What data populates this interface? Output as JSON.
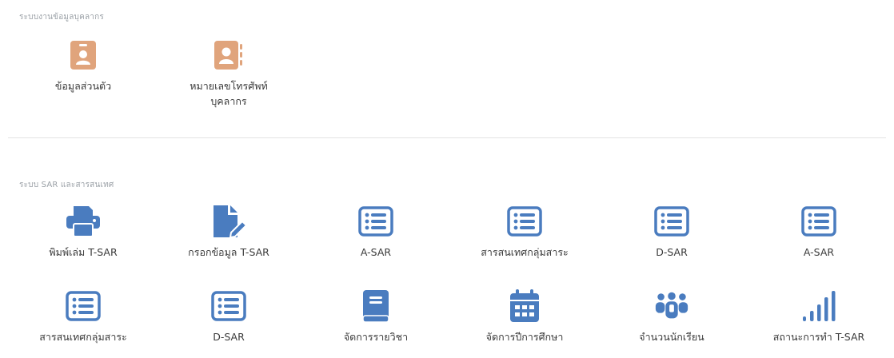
{
  "colors": {
    "personnel_icon": "#e0a47c",
    "sar_icon": "#4a7cbf",
    "divider": "#e3e3e3",
    "section_label": "#9aa0a6"
  },
  "personnel": {
    "section_label": "ระบบงานข้อมูลบุคลากร",
    "items": [
      {
        "label": "ข้อมูลส่วนตัว",
        "icon": "id-badge-icon"
      },
      {
        "label": "หมายเลขโทรศัพท์",
        "label2": "บุคลากร",
        "icon": "contact-book-icon"
      }
    ]
  },
  "sar": {
    "section_label": "ระบบ SAR และสารสนเทศ",
    "row1": [
      {
        "label": "พิมพ์เล่ม T-SAR",
        "icon": "printer-icon"
      },
      {
        "label": "กรอกข้อมูล T-SAR",
        "icon": "file-edit-icon"
      },
      {
        "label": "A-SAR",
        "icon": "list-icon"
      },
      {
        "label": "สารสนเทศกลุ่มสาระ",
        "icon": "list-icon"
      },
      {
        "label": "D-SAR",
        "icon": "list-icon"
      },
      {
        "label": "A-SAR",
        "icon": "list-icon"
      }
    ],
    "row2": [
      {
        "label": "สารสนเทศกลุ่มสาระ",
        "icon": "list-icon"
      },
      {
        "label": "D-SAR",
        "icon": "list-icon"
      },
      {
        "label": "จัดการรายวิชา",
        "icon": "book-icon"
      },
      {
        "label": "จัดการปีการศึกษา",
        "icon": "calendar-icon"
      },
      {
        "label": "จำนวนนักเรียน",
        "icon": "users-icon"
      },
      {
        "label": "สถานะการทำ T-SAR",
        "icon": "signal-bars-icon"
      }
    ]
  }
}
